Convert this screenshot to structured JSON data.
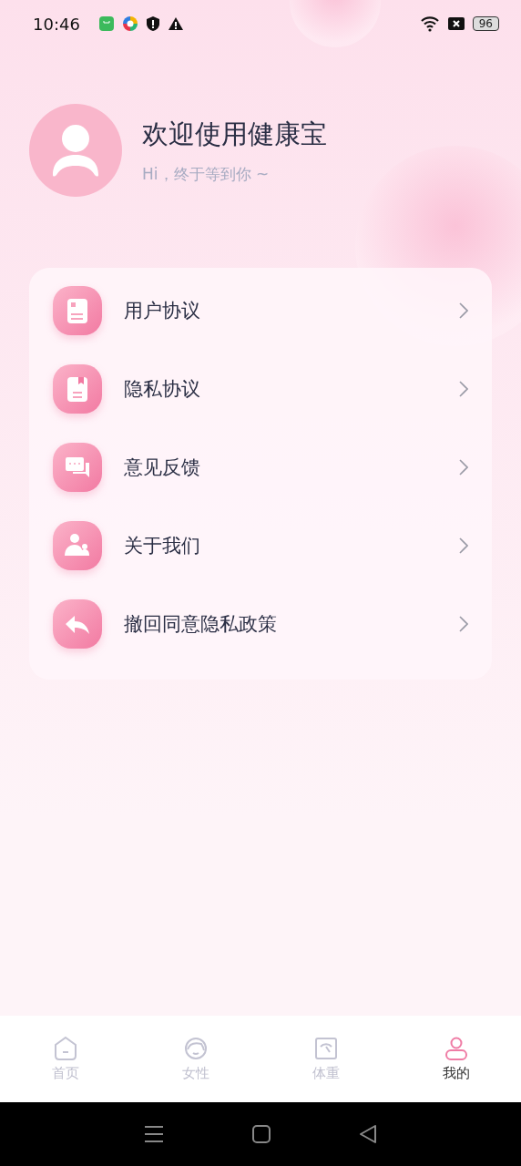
{
  "status_bar": {
    "time": "10:46",
    "notification_icons": [
      {
        "kind": "store"
      },
      {
        "kind": "pinwheel"
      },
      {
        "kind": "shield"
      },
      {
        "kind": "warning"
      }
    ],
    "battery": "96"
  },
  "profile": {
    "title": "欢迎使用健康宝",
    "subtitle": "Hi，终于等到你 ~"
  },
  "menu": [
    {
      "kind": "doc",
      "label": "用户协议"
    },
    {
      "kind": "bookmark",
      "label": "隐私协议"
    },
    {
      "kind": "chat",
      "label": "意见反馈"
    },
    {
      "kind": "people",
      "label": "关于我们"
    },
    {
      "kind": "reply",
      "label": "撤回同意隐私政策"
    }
  ],
  "tabs": [
    {
      "kind": "home",
      "label": "首页",
      "selected": false
    },
    {
      "kind": "female",
      "label": "女性",
      "selected": false
    },
    {
      "kind": "scale",
      "label": "体重",
      "selected": false
    },
    {
      "kind": "user",
      "label": "我的",
      "selected": true
    }
  ]
}
